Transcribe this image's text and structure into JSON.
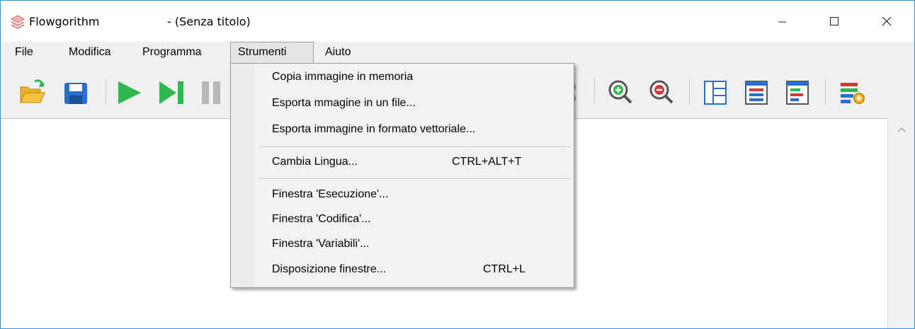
{
  "window": {
    "app_name": "Flowgorithm",
    "doc_title": "- (Senza titolo)"
  },
  "menubar": {
    "items": [
      {
        "label": "File"
      },
      {
        "label": "Modifica"
      },
      {
        "label": "Programma"
      },
      {
        "label": "Strumenti",
        "active": true
      },
      {
        "label": "Aiuto"
      }
    ]
  },
  "toolbar": {
    "buttons": [
      "open-icon",
      "save-icon",
      "run-icon",
      "step-icon",
      "pause-icon",
      "zoom-in-icon",
      "zoom-out-icon",
      "layout-icon",
      "code-window-icon",
      "variables-window-icon",
      "settings-icon"
    ]
  },
  "strumenti_menu": {
    "items": [
      {
        "label": "Copia immagine in memoria",
        "shortcut": ""
      },
      {
        "label": "Esporta mmagine in un file...",
        "shortcut": ""
      },
      {
        "label": "Esporta immagine in formato vettoriale...",
        "shortcut": ""
      },
      {
        "label": "Cambia Lingua...",
        "shortcut": "CTRL+ALT+T"
      },
      {
        "label": "Finestra 'Esecuzione'...",
        "shortcut": ""
      },
      {
        "label": "Finestra 'Codifica'...",
        "shortcut": ""
      },
      {
        "label": "Finestra 'Variabili'...",
        "shortcut": ""
      },
      {
        "label": "Disposizione finestre...",
        "shortcut": "CTRL+L"
      }
    ]
  },
  "colors": {
    "accent_border": "#3b8fd6",
    "run_green": "#2eb84f",
    "save_blue": "#2a6fc9",
    "folder_yellow": "#f5c242"
  }
}
